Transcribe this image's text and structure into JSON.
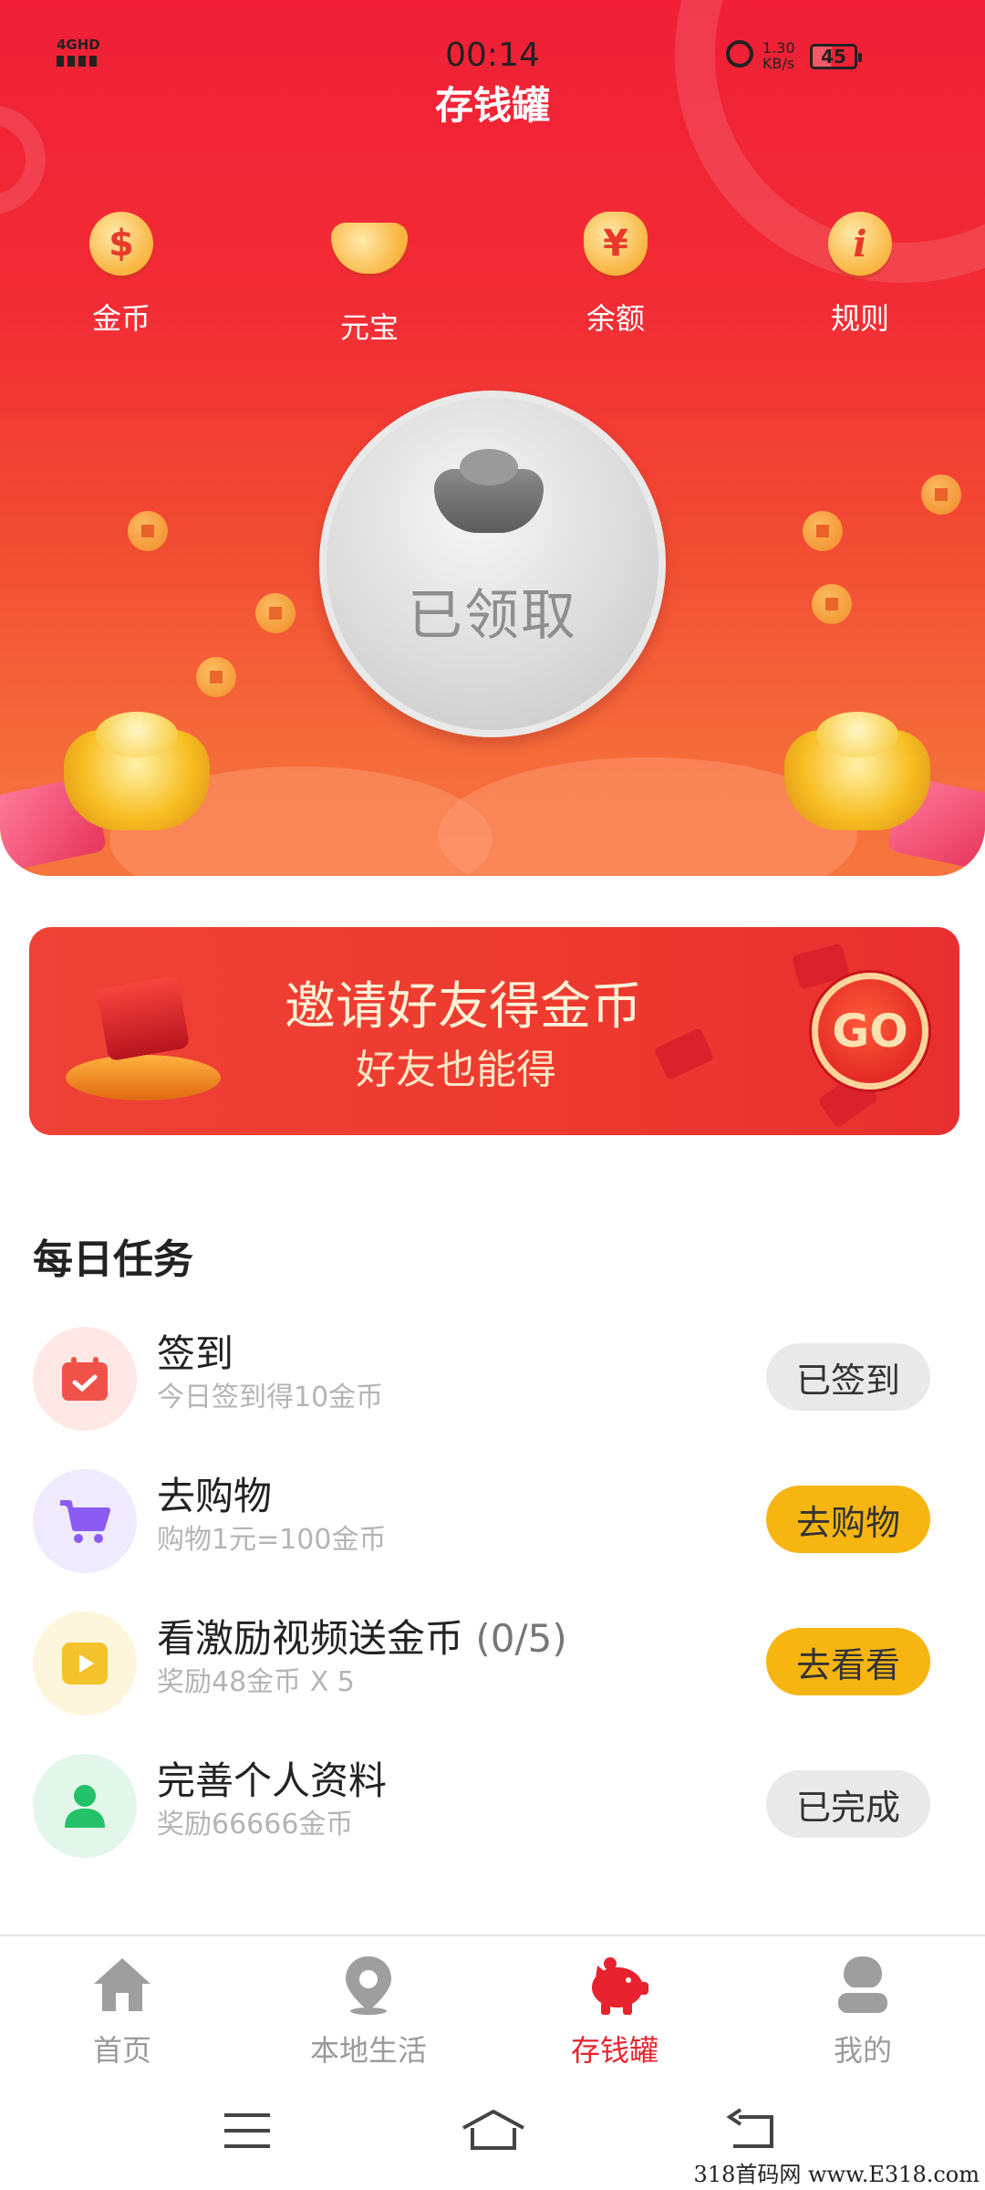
{
  "status_bar": {
    "network": "4GHD",
    "time": "00:14",
    "speed_value": "1.30",
    "speed_unit": "KB/s",
    "battery": "45"
  },
  "header": {
    "title": "存钱罐"
  },
  "quick_nav": [
    {
      "label": "金币",
      "icon": "dollar-coin-icon"
    },
    {
      "label": "元宝",
      "icon": "gold-ingot-icon"
    },
    {
      "label": "余额",
      "icon": "money-bag-icon"
    },
    {
      "label": "规则",
      "icon": "info-icon"
    }
  ],
  "claim_button": {
    "label": "已领取",
    "state": "claimed"
  },
  "invite_banner": {
    "headline": "邀请好友得金币",
    "subline": "好友也能得",
    "go_label": "GO"
  },
  "daily_tasks": {
    "title": "每日任务",
    "items": [
      {
        "name": "签到",
        "count": "",
        "desc": "今日签到得10金币",
        "action": "已签到",
        "state": "done",
        "icon": "calendar-check-icon",
        "icon_bg": "#fde8e6",
        "icon_color": "#f0524a"
      },
      {
        "name": "去购物",
        "count": "",
        "desc": "购物1元=100金币",
        "action": "去购物",
        "state": "active",
        "icon": "shopping-cart-icon",
        "icon_bg": "#efeafd",
        "icon_color": "#8a5cf2"
      },
      {
        "name": "看激励视频送金币",
        "count": "(0/5)",
        "desc": "奖励48金币 X 5",
        "action": "去看看",
        "state": "active",
        "icon": "video-play-icon",
        "icon_bg": "#fdf6dc",
        "icon_color": "#f4c22a"
      },
      {
        "name": "完善个人资料",
        "count": "",
        "desc": "奖励66666金币",
        "action": "已完成",
        "state": "done",
        "icon": "user-profile-icon",
        "icon_bg": "#e3f6ea",
        "icon_color": "#23c26a"
      }
    ]
  },
  "tab_bar": [
    {
      "label": "首页",
      "icon": "home-icon",
      "active": false
    },
    {
      "label": "本地生活",
      "icon": "location-pin-icon",
      "active": false
    },
    {
      "label": "存钱罐",
      "icon": "piggy-bank-icon",
      "active": true
    },
    {
      "label": "我的",
      "icon": "user-icon",
      "active": false
    }
  ],
  "colors": {
    "accent": "#e8232f",
    "hero_red": "#f01f36",
    "action_yellow": "#f7b512"
  },
  "watermark": "318首码网 www.E318.com"
}
